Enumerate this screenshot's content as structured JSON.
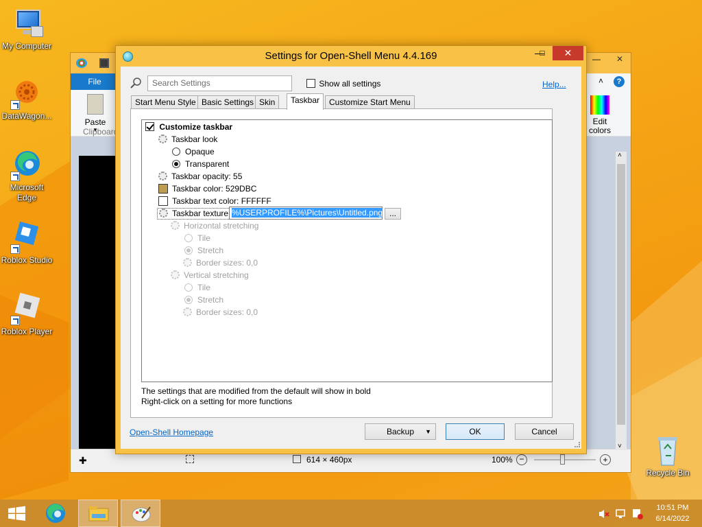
{
  "desktop": {
    "icons": [
      {
        "label": "My Computer"
      },
      {
        "label": "DataWagon..."
      },
      {
        "label": "Microsoft Edge"
      },
      {
        "label": "Roblox Studio"
      },
      {
        "label": "Roblox Player"
      },
      {
        "label": "Recycle Bin"
      }
    ]
  },
  "paint": {
    "file_tab": "File",
    "paste_label": "Paste",
    "clipboard_group": "Clipboard",
    "edit_colors": "Edit colors",
    "status_size": "614 × 460px",
    "zoom": "100%"
  },
  "dialog": {
    "title": "Settings for Open-Shell Menu 4.4.169",
    "search_placeholder": "Search Settings",
    "show_all": "Show all settings",
    "help": "Help...",
    "tabs": [
      "Start Menu Style",
      "Basic Settings",
      "Skin",
      "Taskbar",
      "Customize Start Menu"
    ],
    "active_tab": "Taskbar",
    "settings": {
      "customize_taskbar": "Customize taskbar",
      "taskbar_look": "Taskbar look",
      "opaque": "Opaque",
      "transparent": "Transparent",
      "opacity": "Taskbar opacity: 55",
      "color": "Taskbar color: 529DBC",
      "text_color": "Taskbar text color: FFFFFF",
      "texture": "Taskbar texture",
      "texture_value": "%USERPROFILE%\\Pictures\\Untitled.png",
      "browse": "...",
      "h_stretch": "Horizontal stretching",
      "tile": "Tile",
      "stretch": "Stretch",
      "border_sizes": "Border sizes: 0,0",
      "v_stretch": "Vertical stretching"
    },
    "colors": {
      "taskbar_color": "#BC9D52",
      "text_color": "#FFFFFF"
    },
    "note1": "The settings that are modified from the default will show in bold",
    "note2": "Right-click on a setting for more functions",
    "homepage": "Open-Shell Homepage",
    "backup": "Backup",
    "ok": "OK",
    "cancel": "Cancel"
  },
  "taskbar": {
    "time": "10:51 PM",
    "date": "6/14/2022"
  }
}
